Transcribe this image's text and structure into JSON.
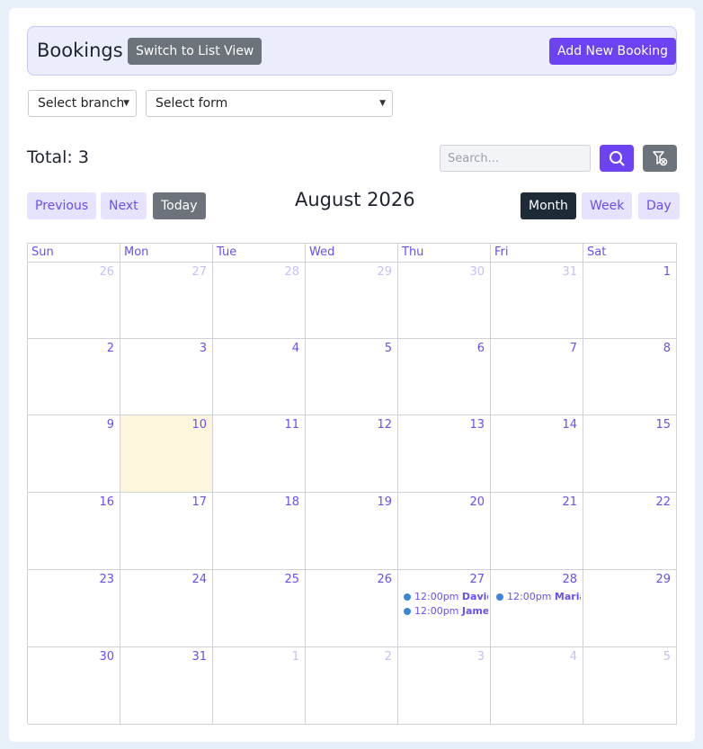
{
  "header": {
    "title": "Bookings",
    "switch_label": "Switch to List View",
    "add_label": "Add New Booking"
  },
  "filters": {
    "branch": "Select branch",
    "form": "Select form"
  },
  "summary": {
    "total": "Total: 3"
  },
  "search": {
    "placeholder": "Search..."
  },
  "toolbar": {
    "previous": "Previous",
    "next": "Next",
    "today": "Today",
    "month_title": "August 2026",
    "views": [
      "Month",
      "Week",
      "Day"
    ],
    "active_view": "Month"
  },
  "calendar": {
    "weekdays": [
      "Sun",
      "Mon",
      "Tue",
      "Wed",
      "Thu",
      "Fri",
      "Sat"
    ],
    "today": "10",
    "weeks": [
      [
        {
          "d": "26",
          "o": true
        },
        {
          "d": "27",
          "o": true
        },
        {
          "d": "28",
          "o": true
        },
        {
          "d": "29",
          "o": true
        },
        {
          "d": "30",
          "o": true
        },
        {
          "d": "31",
          "o": true
        },
        {
          "d": "1",
          "o": false
        }
      ],
      [
        {
          "d": "2",
          "o": false
        },
        {
          "d": "3",
          "o": false
        },
        {
          "d": "4",
          "o": false
        },
        {
          "d": "5",
          "o": false
        },
        {
          "d": "6",
          "o": false
        },
        {
          "d": "7",
          "o": false
        },
        {
          "d": "8",
          "o": false
        }
      ],
      [
        {
          "d": "9",
          "o": false
        },
        {
          "d": "10",
          "o": false
        },
        {
          "d": "11",
          "o": false
        },
        {
          "d": "12",
          "o": false
        },
        {
          "d": "13",
          "o": false
        },
        {
          "d": "14",
          "o": false
        },
        {
          "d": "15",
          "o": false
        }
      ],
      [
        {
          "d": "16",
          "o": false
        },
        {
          "d": "17",
          "o": false
        },
        {
          "d": "18",
          "o": false
        },
        {
          "d": "19",
          "o": false
        },
        {
          "d": "20",
          "o": false
        },
        {
          "d": "21",
          "o": false
        },
        {
          "d": "22",
          "o": false
        }
      ],
      [
        {
          "d": "23",
          "o": false
        },
        {
          "d": "24",
          "o": false
        },
        {
          "d": "25",
          "o": false
        },
        {
          "d": "26",
          "o": false
        },
        {
          "d": "27",
          "o": false,
          "events": [
            {
              "time": "12:00pm",
              "who": "David C"
            },
            {
              "time": "12:00pm",
              "who": "James"
            }
          ]
        },
        {
          "d": "28",
          "o": false,
          "events": [
            {
              "time": "12:00pm",
              "who": "Maria I"
            }
          ]
        },
        {
          "d": "29",
          "o": false
        }
      ],
      [
        {
          "d": "30",
          "o": false
        },
        {
          "d": "31",
          "o": false
        },
        {
          "d": "1",
          "o": true
        },
        {
          "d": "2",
          "o": true
        },
        {
          "d": "3",
          "o": true
        },
        {
          "d": "4",
          "o": true
        },
        {
          "d": "5",
          "o": true
        }
      ]
    ]
  },
  "colors": {
    "accent": "#6d42f2",
    "event_dot": "#3b86d8",
    "today_bg": "#fdf6dd"
  }
}
